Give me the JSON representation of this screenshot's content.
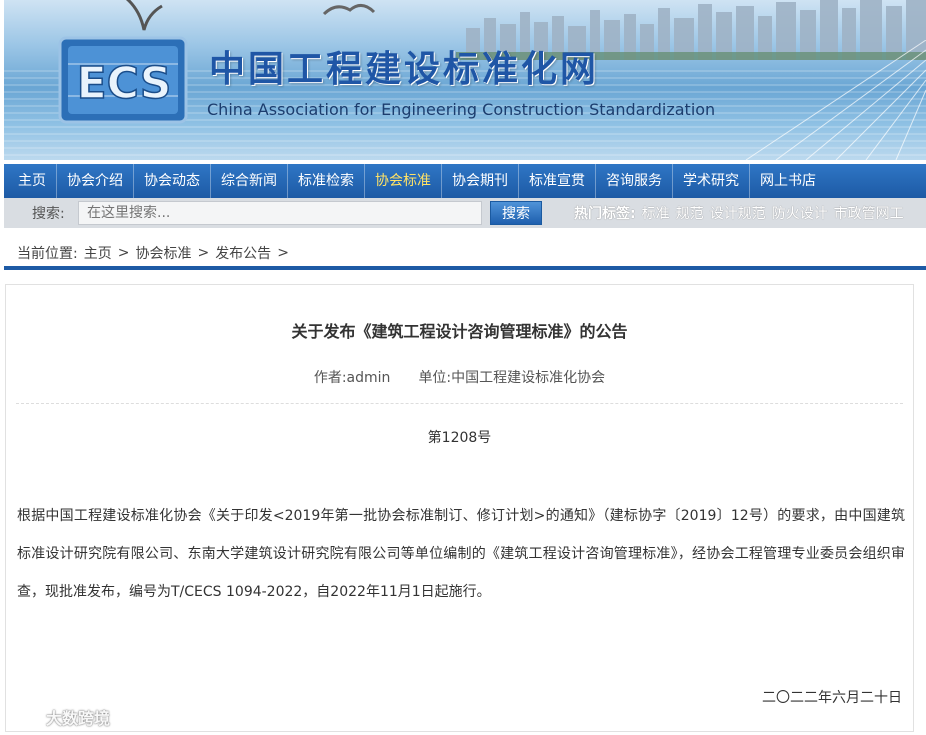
{
  "banner": {
    "logo_text": "ECS",
    "title": "中国工程建设标准化网",
    "subtitle": "China Association for Engineering Construction Standardization"
  },
  "nav": {
    "items": [
      {
        "label": "主页"
      },
      {
        "label": "协会介绍"
      },
      {
        "label": "协会动态"
      },
      {
        "label": "综合新闻"
      },
      {
        "label": "标准检索"
      },
      {
        "label": "协会标准",
        "active": true
      },
      {
        "label": "协会期刊"
      },
      {
        "label": "标准宣贯"
      },
      {
        "label": "咨询服务"
      },
      {
        "label": "学术研究"
      },
      {
        "label": "网上书店"
      }
    ]
  },
  "search": {
    "label": "搜索:",
    "placeholder": "在这里搜索...",
    "button": "搜索",
    "hot_label": "热门标签:",
    "hot_tags": [
      "标准",
      "规范",
      "设计规范",
      "防火设计",
      "市政管网工"
    ]
  },
  "breadcrumb": {
    "prefix": "当前位置:",
    "items": [
      "主页",
      "协会标准",
      "发布公告"
    ],
    "separator": ">"
  },
  "article": {
    "title": "关于发布《建筑工程设计咨询管理标准》的公告",
    "author": "作者:admin",
    "unit": "单位:中国工程建设标准化协会",
    "number": "第1208号",
    "body": "根据中国工程建设标准化协会《关于印发<2019年第一批协会标准制订、修订计划>的通知》（建标协字〔2019〕12号）的要求，由中国建筑标准设计研究院有限公司、东南大学建筑设计研究院有限公司等单位编制的《建筑工程设计咨询管理标准》，经协会工程管理专业委员会组织审查，现批准发布，编号为T/CECS 1094-2022，自2022年11月1日起施行。",
    "date": "二〇二二年六月二十日"
  },
  "watermark": "大数跨境",
  "colors": {
    "nav_bg": "#1d5aa5",
    "nav_active": "#ffe266",
    "title_blue": "#1f56a6",
    "searchbar_bg": "#d9dde2"
  }
}
